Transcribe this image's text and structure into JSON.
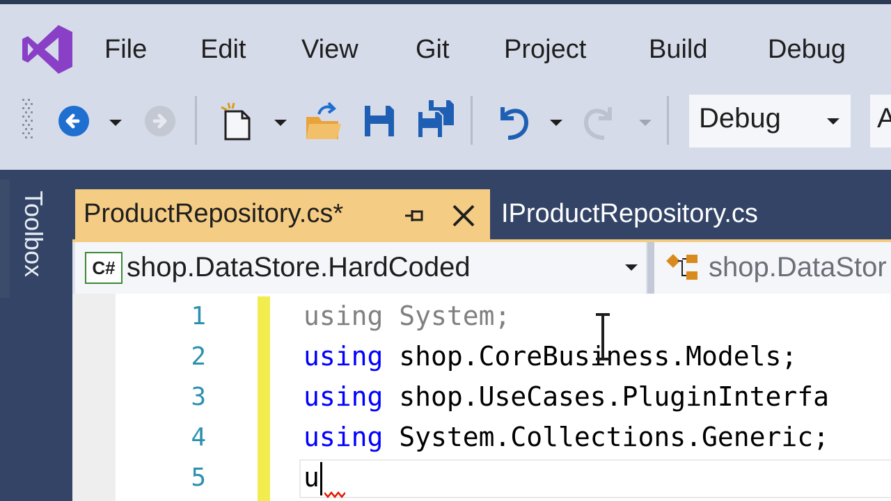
{
  "menu": {
    "items": [
      "File",
      "Edit",
      "View",
      "Git",
      "Project",
      "Build",
      "Debug"
    ]
  },
  "toolbar": {
    "configuration": "Debug",
    "platform_partial": "A",
    "icons": [
      "navigate-back-icon",
      "navigate-forward-icon",
      "new-item-icon",
      "open-file-icon",
      "save-icon",
      "save-all-icon",
      "undo-icon",
      "redo-icon"
    ]
  },
  "toolbox": {
    "label": "Toolbox"
  },
  "tabs": [
    {
      "label": "ProductRepository.cs*",
      "active": true
    },
    {
      "label": "IProductRepository.cs",
      "active": false
    }
  ],
  "navbar": {
    "project_badge": "C#",
    "project": "shop.DataStore.HardCoded",
    "type_partial": "shop.DataStor"
  },
  "editor": {
    "line_numbers": [
      "1",
      "2",
      "3",
      "4",
      "5"
    ],
    "lines": [
      {
        "kw": "using",
        "rest": " System;"
      },
      {
        "kw": "using",
        "rest": " shop.CoreBusiness.Models;"
      },
      {
        "kw": "using",
        "rest": " shop.UseCases.PluginInterfa"
      },
      {
        "kw": "using",
        "rest": " System.Collections.Generic;"
      },
      {
        "kw": "",
        "rest": "u"
      }
    ]
  },
  "colors": {
    "accent": "#68217a",
    "tab_active": "#f5cc84",
    "keyword": "#0000ff",
    "line_number": "#2b91af",
    "change_marker": "#f2ec4e"
  }
}
